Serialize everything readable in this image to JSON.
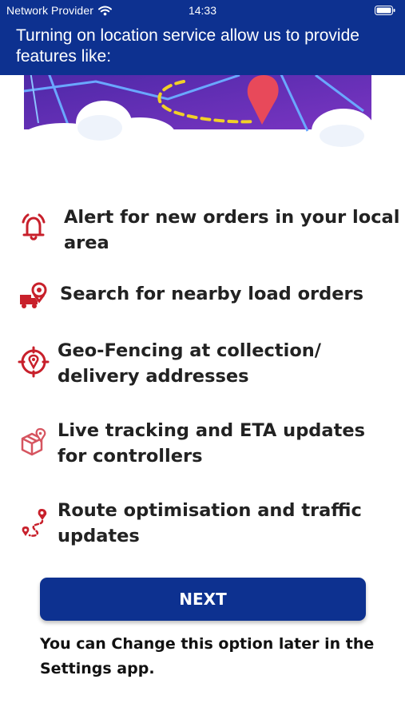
{
  "status_bar": {
    "carrier": "Network Provider",
    "time": "14:33",
    "wifi_icon": "wifi-icon",
    "battery_icon": "battery-icon"
  },
  "header": {
    "title": "Turning on location service allow us to provide features like:"
  },
  "features": [
    {
      "icon": "bell-alert-icon",
      "label": "Alert for new orders in your local area"
    },
    {
      "icon": "truck-location-icon",
      "label": "Search for nearby load orders"
    },
    {
      "icon": "geofence-target-icon",
      "label": "Geo-Fencing at collection/ delivery addresses"
    },
    {
      "icon": "package-tracking-icon",
      "label": "Live tracking and ETA updates for controllers"
    },
    {
      "icon": "route-icon",
      "label": "Route optimisation and traffic updates"
    }
  ],
  "next_button": {
    "label": "NEXT"
  },
  "footer_note": "You can Change this option later in the Settings app.",
  "colors": {
    "primary": "#0d3190",
    "icon_red": "#c8202b",
    "hero_purple": "#5b2ea8",
    "route_yellow": "#f2d027",
    "pin_red": "#e8495a"
  }
}
